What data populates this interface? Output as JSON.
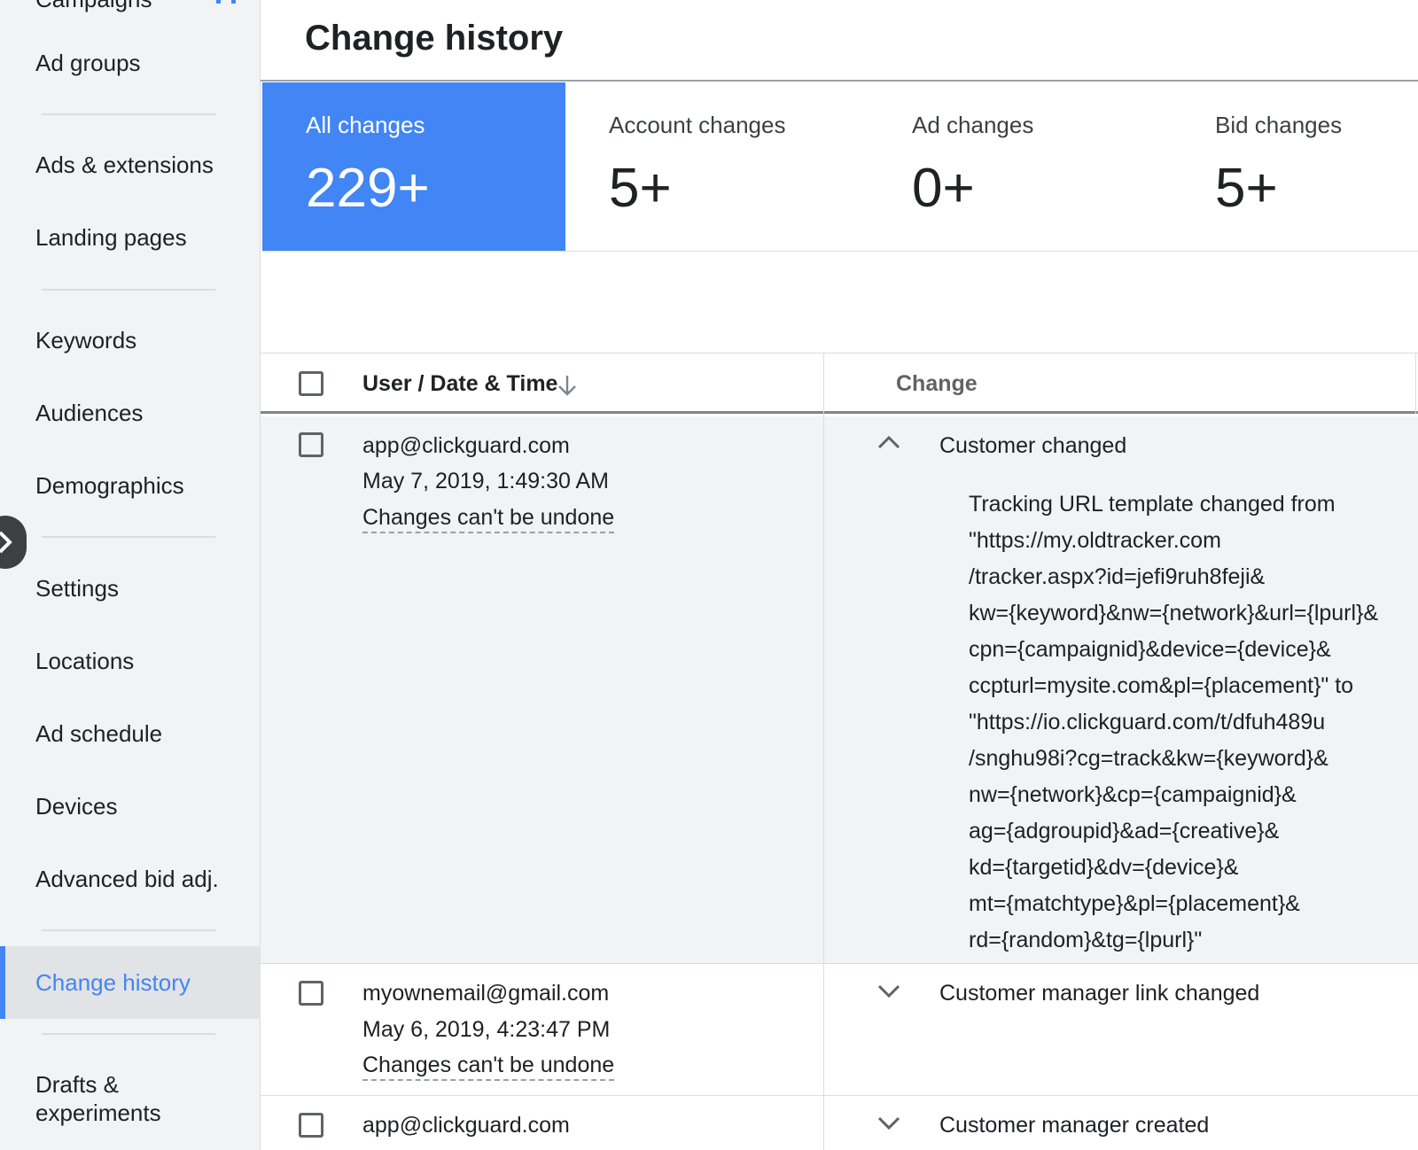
{
  "sidebar": {
    "cut_item": "Campaigns",
    "items": [
      {
        "label": "Ad groups"
      },
      {
        "label": "Ads & extensions"
      },
      {
        "label": "Landing pages"
      },
      {
        "label": "Keywords"
      },
      {
        "label": "Audiences"
      },
      {
        "label": "Demographics"
      },
      {
        "label": "Settings"
      },
      {
        "label": "Locations"
      },
      {
        "label": "Ad schedule"
      },
      {
        "label": "Devices"
      },
      {
        "label": "Advanced bid adj."
      },
      {
        "label": "Change history"
      },
      {
        "label": "Drafts &"
      },
      {
        "label": "experiments"
      }
    ],
    "active_index": 11
  },
  "header": {
    "title": "Change history"
  },
  "cards": [
    {
      "label": "All changes",
      "value": "229+"
    },
    {
      "label": "Account changes",
      "value": "5+"
    },
    {
      "label": "Ad changes",
      "value": "0+"
    },
    {
      "label": "Bid changes",
      "value": "5+"
    }
  ],
  "table": {
    "col_user": "User / Date & Time",
    "col_change": "Change",
    "rows": [
      {
        "user": "app@clickguard.com",
        "datetime": "May 7, 2019, 1:49:30 AM",
        "undo": "Changes can't be undone",
        "change": "Customer changed",
        "detail": [
          "Tracking URL template changed from",
          "\"https://my.oldtracker.com",
          "/tracker.aspx?id=jefi9ruh8feji&",
          "kw={keyword}&nw={network}&url={lpurl}&",
          "cpn={campaignid}&device={device}&",
          "ccpturl=mysite.com&pl={placement}\" to",
          "\"https://io.clickguard.com/t/dfuh489u",
          "/snghu98i?cg=track&kw={keyword}&",
          "nw={network}&cp={campaignid}&",
          "ag={adgroupid}&ad={creative}&",
          "kd={targetid}&dv={device}&",
          "mt={matchtype}&pl={placement}&",
          "rd={random}&tg={lpurl}\""
        ]
      },
      {
        "user": "myownemail@gmail.com",
        "datetime": "May 6, 2019, 4:23:47 PM",
        "undo": "Changes can't be undone",
        "change": "Customer manager link changed"
      },
      {
        "user": "app@clickguard.com",
        "change": "Customer manager created"
      }
    ]
  }
}
